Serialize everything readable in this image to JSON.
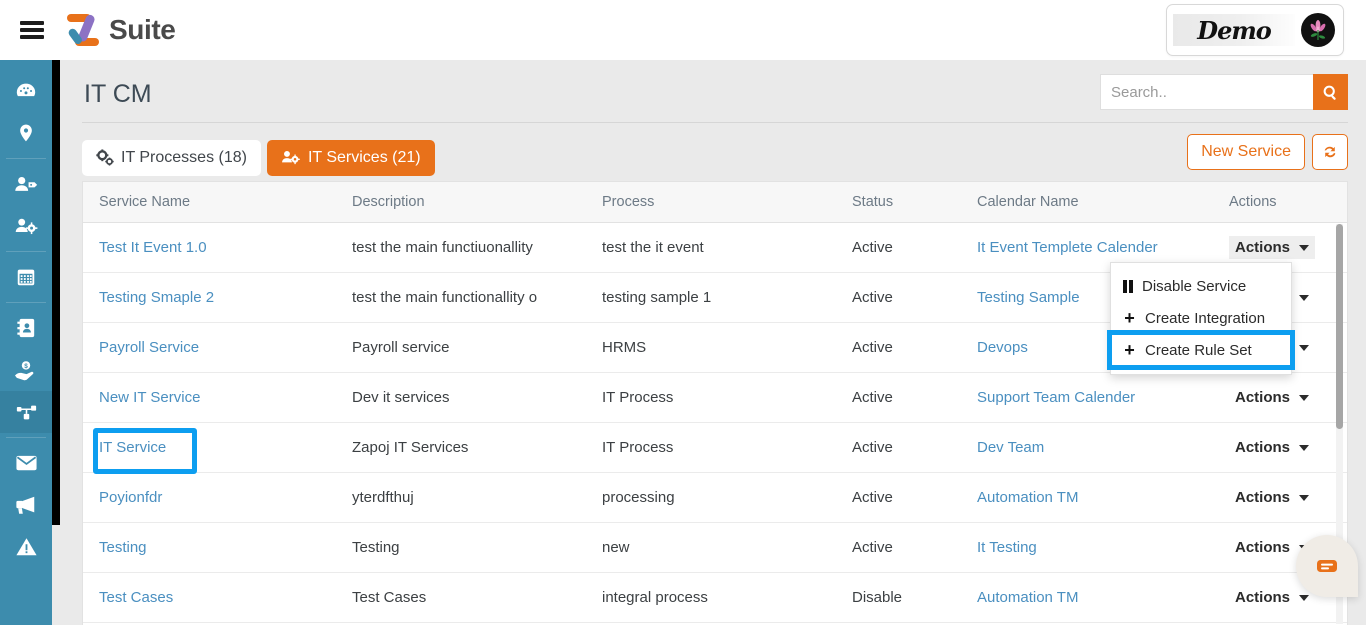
{
  "app": {
    "brand_name": "Suite",
    "menu_icon": "hamburger-icon",
    "logo_icon": "z-logo-icon",
    "tenant_label": "Demo",
    "avatar_icon": "flower-avatar-icon"
  },
  "sidebar": {
    "items": [
      {
        "icon": "dashboard-icon",
        "name": "dashboard",
        "active": false
      },
      {
        "icon": "location-pin-icon",
        "name": "locations",
        "active": false
      },
      {
        "icon": "user-tag-icon",
        "name": "contacts",
        "active": false
      },
      {
        "icon": "users-cog-icon",
        "name": "teams",
        "active": false
      },
      {
        "icon": "calendar-icon",
        "name": "calendar",
        "active": false
      },
      {
        "icon": "address-book-icon",
        "name": "directory",
        "active": false
      },
      {
        "icon": "hand-dollar-icon",
        "name": "billing",
        "active": false
      },
      {
        "icon": "sitemap-icon",
        "name": "it-cm",
        "active": true
      },
      {
        "icon": "envelope-icon",
        "name": "messages",
        "active": false
      },
      {
        "icon": "bullhorn-icon",
        "name": "announcements",
        "active": false
      },
      {
        "icon": "warning-triangle-icon",
        "name": "alerts",
        "active": false
      }
    ]
  },
  "page": {
    "title": "IT CM"
  },
  "search": {
    "placeholder": "Search..",
    "value": "",
    "button_icon": "search-icon"
  },
  "tabs": [
    {
      "label": "IT Processes (18)",
      "icon": "cogs-icon",
      "active": false
    },
    {
      "label": "IT Services (21)",
      "icon": "users-cog-icon",
      "active": true
    }
  ],
  "toolbar": {
    "new_service_label": "New Service",
    "refresh_icon": "sync-refresh-icon"
  },
  "table": {
    "columns": [
      "Service Name",
      "Description",
      "Process",
      "Status",
      "Calendar Name",
      "Actions"
    ],
    "action_label": "Actions",
    "rows": [
      {
        "service_name": "Test It Event 1.0",
        "description": "test the main functiuonallity",
        "process": "test the it event",
        "status": "Active",
        "calendar_name": "It Event Templete Calender",
        "actions": "Actions"
      },
      {
        "service_name": "Testing Smaple 2",
        "description": "test the main functionallity o",
        "process": "testing sample 1",
        "status": "Active",
        "calendar_name": "Testing Sample",
        "actions": "Actions"
      },
      {
        "service_name": "Payroll Service",
        "description": "Payroll service",
        "process": "HRMS",
        "status": "Active",
        "calendar_name": "Devops",
        "actions": "Actions"
      },
      {
        "service_name": "New IT Service",
        "description": "Dev it services",
        "process": "IT Process",
        "status": "Active",
        "calendar_name": "Support Team Calender",
        "actions": "Actions"
      },
      {
        "service_name": "IT Service",
        "description": "Zapoj IT Services",
        "process": "IT Process",
        "status": "Active",
        "calendar_name": "Dev Team",
        "actions": "Actions"
      },
      {
        "service_name": "Poyionfdr",
        "description": "yterdfthuj",
        "process": "processing",
        "status": "Active",
        "calendar_name": "Automation TM",
        "actions": "Actions"
      },
      {
        "service_name": "Testing",
        "description": "Testing",
        "process": "new",
        "status": "Active",
        "calendar_name": "It Testing",
        "actions": "Actions"
      },
      {
        "service_name": "Test Cases",
        "description": "Test Cases",
        "process": "integral process",
        "status": "Disable",
        "calendar_name": "Automation TM",
        "actions": "Actions"
      }
    ]
  },
  "dropdown": {
    "open_for_row": 0,
    "items": [
      {
        "label": "Disable Service",
        "icon": "pause-icon",
        "highlighted": false
      },
      {
        "label": "Create Integration",
        "icon": "plus-icon",
        "highlighted": false
      },
      {
        "label": "Create Rule Set",
        "icon": "plus-icon",
        "highlighted": true
      }
    ]
  },
  "chat": {
    "icon": "chat-message-icon"
  },
  "colors": {
    "accent_orange": "#e8711a",
    "sidebar_blue": "#3d8cad",
    "link_blue": "#4a8fc0",
    "highlight_blue": "#0d9ef0"
  }
}
